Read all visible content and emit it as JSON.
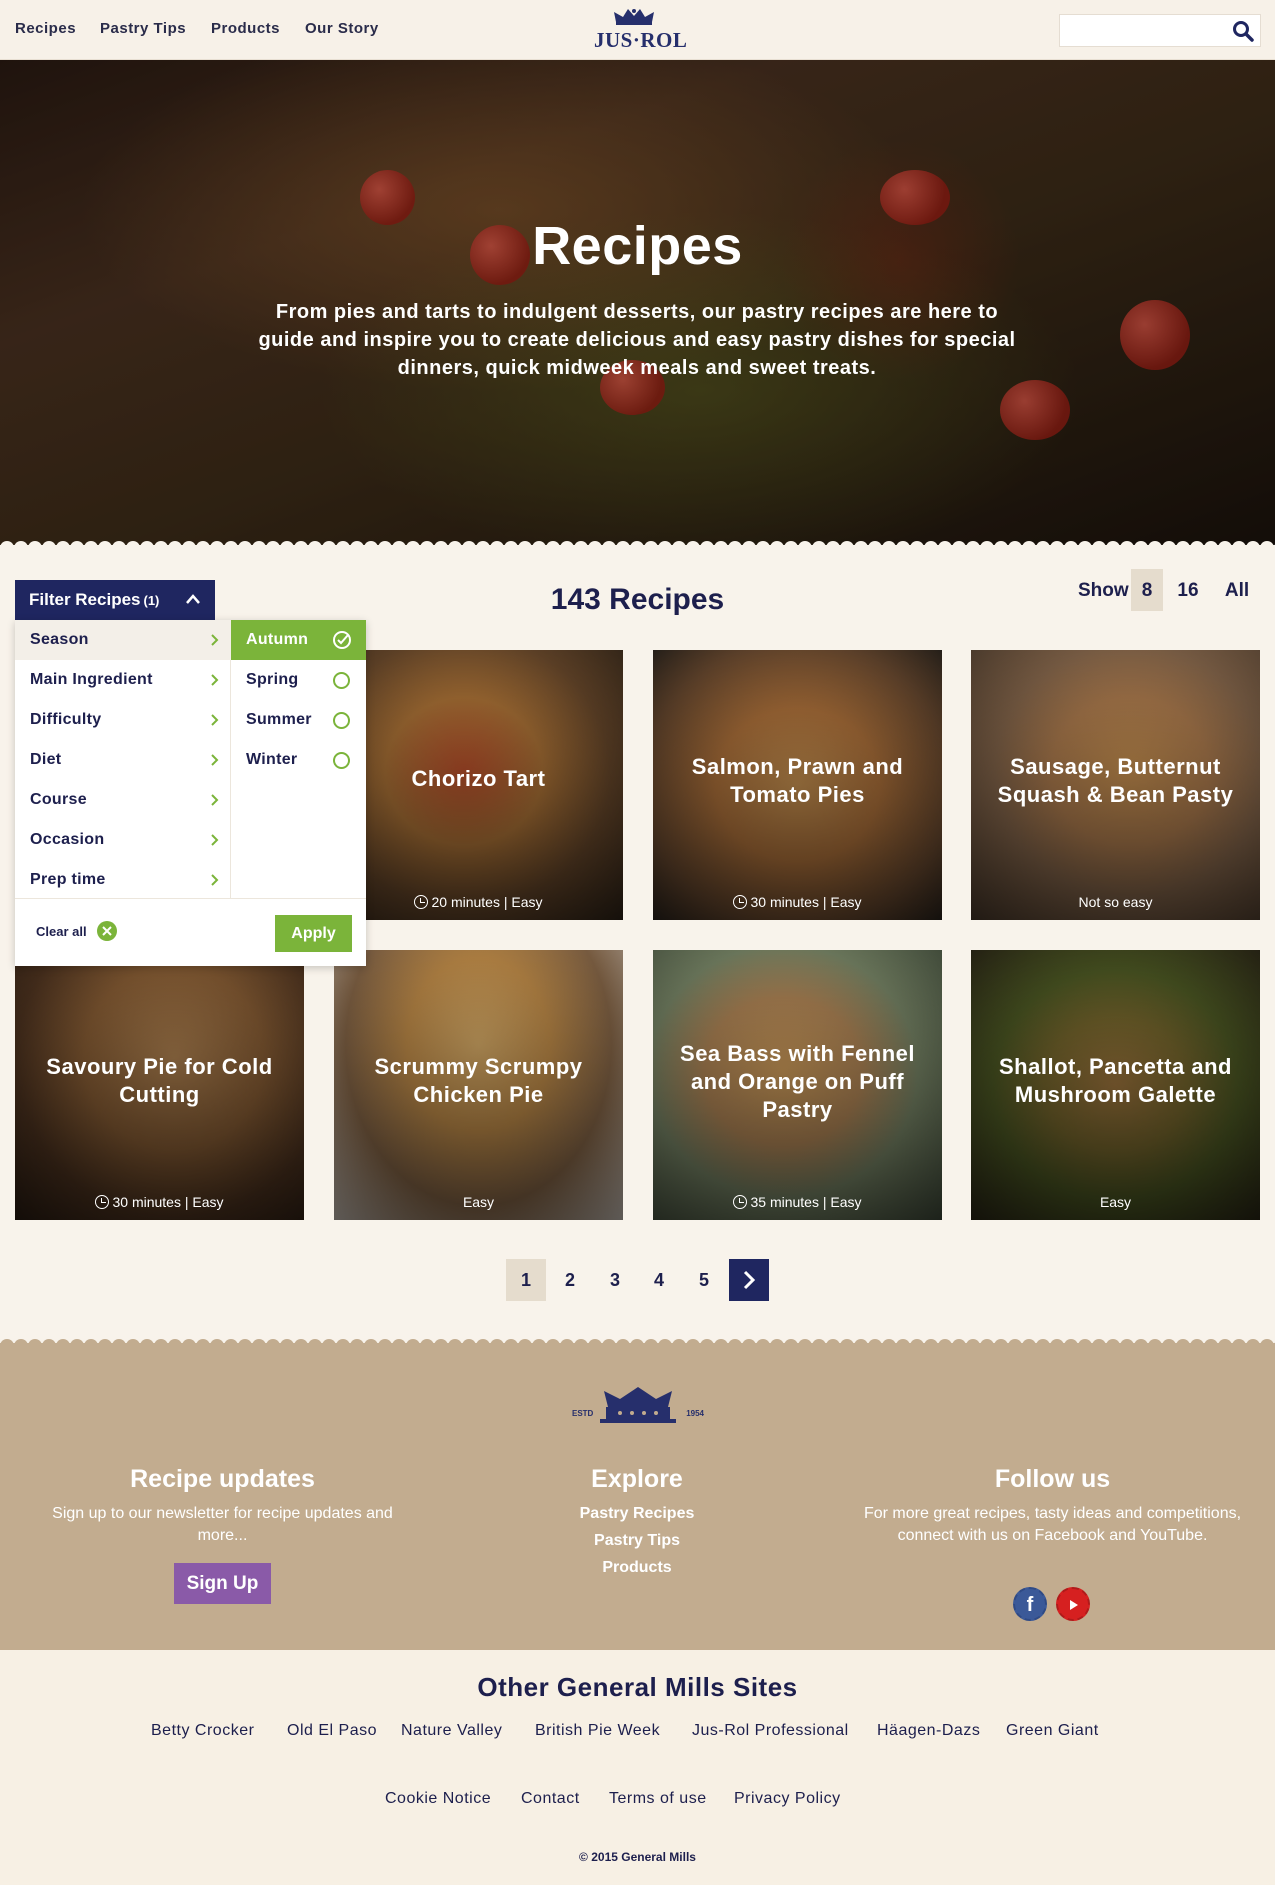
{
  "header": {
    "nav": [
      "Recipes",
      "Pastry Tips",
      "Products",
      "Our Story"
    ],
    "logo": "JUS·ROL",
    "search_placeholder": ""
  },
  "hero": {
    "title": "Recipes",
    "description": "From pies and tarts to indulgent desserts, our pastry recipes are here to guide and inspire you to create delicious and easy pastry dishes for special dinners, quick midweek meals and sweet treats."
  },
  "filter": {
    "button_label": "Filter Recipes",
    "button_count": "(1)",
    "categories": [
      "Season",
      "Main Ingredient",
      "Difficulty",
      "Diet",
      "Course",
      "Occasion",
      "Prep time"
    ],
    "options": [
      "Autumn",
      "Spring",
      "Summer",
      "Winter"
    ],
    "selected_option": "Autumn",
    "clear_all": "Clear all",
    "apply": "Apply"
  },
  "results": {
    "count_label": "143 Recipes",
    "show_label": "Show",
    "show_options": [
      "8",
      "16",
      "All"
    ],
    "show_selected": "8"
  },
  "recipes": [
    {
      "title": "Chorizo Tart",
      "meta": "20 minutes | Easy",
      "has_time": true
    },
    {
      "title": "Salmon, Prawn and Tomato Pies",
      "meta": "30 minutes | Easy",
      "has_time": true
    },
    {
      "title": "Sausage, Butternut Squash & Bean Pasty",
      "meta": "Not so easy",
      "has_time": false
    },
    {
      "title": "Savoury Pie for Cold Cutting",
      "meta": "30 minutes | Easy",
      "has_time": true
    },
    {
      "title": "Scrummy Scrumpy Chicken Pie",
      "meta": "Easy",
      "has_time": false
    },
    {
      "title": "Sea Bass with Fennel and Orange on Puff Pastry",
      "meta": "35 minutes | Easy",
      "has_time": true
    },
    {
      "title": "Shallot, Pancetta and Mushroom Galette",
      "meta": "Easy",
      "has_time": false
    }
  ],
  "pagination": {
    "pages": [
      "1",
      "2",
      "3",
      "4",
      "5"
    ],
    "current": "1"
  },
  "footer": {
    "logo_left": "ESTD",
    "logo_right": "1954",
    "updates_title": "Recipe updates",
    "updates_text": "Sign up to our newsletter for recipe updates and more...",
    "signup_label": "Sign Up",
    "explore_title": "Explore",
    "explore_links": [
      "Pastry Recipes",
      "Pastry Tips",
      "Products"
    ],
    "follow_title": "Follow us",
    "follow_text": "For more great recipes, tasty ideas and competitions, connect with us on Facebook and YouTube.",
    "facebook": "f",
    "other_sites_title": "Other General Mills Sites",
    "other_sites": [
      "Betty Crocker",
      "Old El Paso",
      "Nature Valley",
      "British Pie Week",
      "Jus-Rol Professional",
      "Häagen-Dazs",
      "Green Giant"
    ],
    "legal_links": [
      "Cookie Notice",
      "Contact",
      "Terms of use",
      "Privacy Policy"
    ],
    "copyright": "© 2015 General Mills"
  },
  "colors": {
    "navy": "#1f2660",
    "green": "#7bb43a",
    "purple": "#8a5aa8",
    "footer_tan": "#c2ac8f",
    "cream": "#f8f3eb"
  }
}
